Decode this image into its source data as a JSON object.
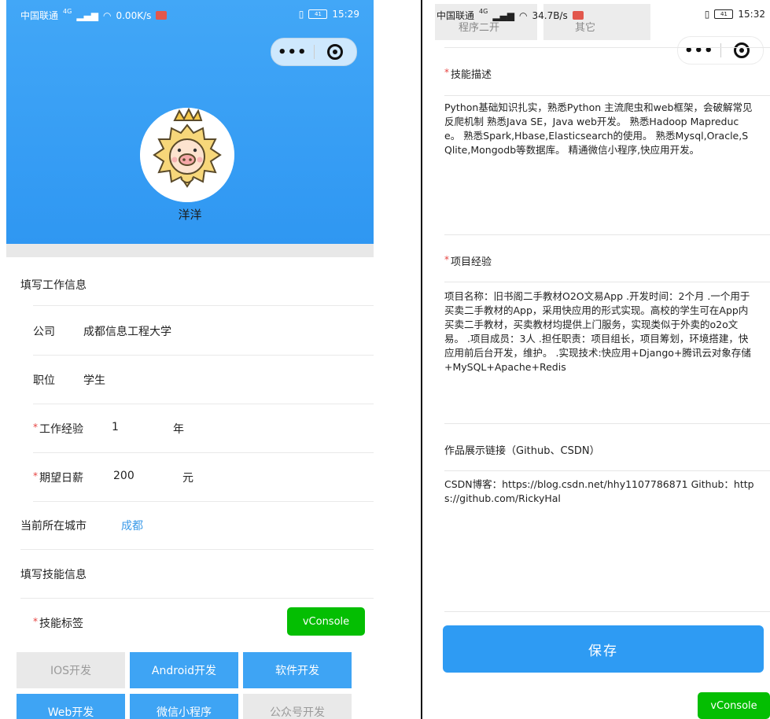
{
  "left": {
    "status": {
      "carrier": "中国联通",
      "network": "4G",
      "speed": "0.00K/s",
      "time": "15:29",
      "battery": "41"
    },
    "profile": {
      "name": "洋洋"
    },
    "work_section": {
      "title": "填写工作信息"
    },
    "company": {
      "label": "公司",
      "value": "成都信息工程大学"
    },
    "position": {
      "label": "职位",
      "value": "学生"
    },
    "experience": {
      "label": "工作经验",
      "value": "1",
      "unit": "年"
    },
    "salary": {
      "label": "期望日薪",
      "value": "200",
      "unit": "元"
    },
    "city": {
      "label": "当前所在城市",
      "value": "成都"
    },
    "skill_section": {
      "title": "填写技能信息"
    },
    "skill_tags": {
      "label": "技能标签"
    },
    "tags": [
      {
        "label": "IOS开发",
        "selected": false
      },
      {
        "label": "Android开发",
        "selected": true
      },
      {
        "label": "软件开发",
        "selected": true
      },
      {
        "label": "Web开发",
        "selected": true
      },
      {
        "label": "微信小程序",
        "selected": true
      },
      {
        "label": "公众号开发",
        "selected": false
      }
    ],
    "vconsole": "vConsole"
  },
  "right": {
    "status": {
      "carrier": "中国联通",
      "network": "4G",
      "speed": "34.7B/s",
      "time": "15:32",
      "battery": "41"
    },
    "header_tabs": [
      "程序二开",
      "其它"
    ],
    "skill_desc": {
      "label": "技能描述",
      "text": "Python基础知识扎实，熟悉Python 主流爬虫和web框架，会破解常见反爬机制 熟悉Java SE，Java web开发。 熟悉Hadoop Mapreduce。 熟悉Spark,Hbase,Elasticsearch的使用。 熟悉Mysql,Oracle,SQlite,Mongodb等数据库。 精通微信小程序,快应用开发。"
    },
    "project": {
      "label": "项目经验",
      "text": "项目名称：旧书阁二手教材O2O文易App .开发时间：2个月 .一个用于买卖二手教材的App，采用快应用的形式实现。高校的学生可在App内买卖二手教材，买卖教材均提供上门服务，实现类似于外卖的o2o文易。 .项目成员：3人 .担任职责：项目组长，项目筹划，环境搭建，快应用前后台开发，维护。 .实现技术:快应用+Django+腾讯云对象存储+MySQL+Apache+Redis"
    },
    "links": {
      "label": "作品展示链接（Github、CSDN）",
      "text": "CSDN博客：https://blog.csdn.net/hhy1107786871 Github：https://github.com/RickyHal"
    },
    "save_label": "保存",
    "vconsole": "vConsole"
  },
  "colors": {
    "primary": "#3ea4f4",
    "vconsole": "#04be02",
    "required": "#e64340",
    "link": "#3b9ae8"
  }
}
